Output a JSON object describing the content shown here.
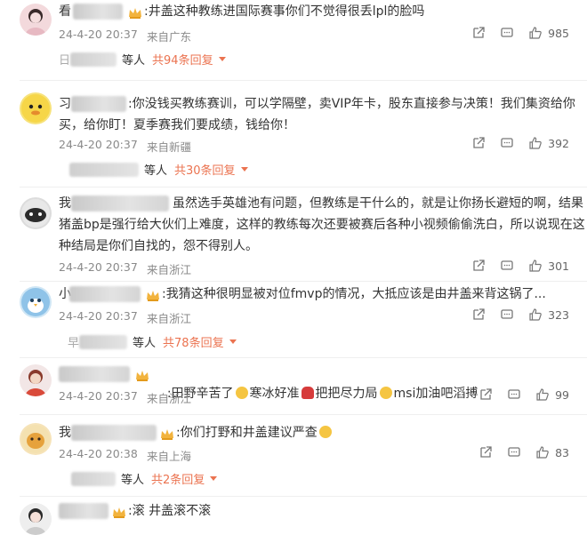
{
  "comments": [
    {
      "name_visible": "看",
      "text": ":井盖这种教练进国际赛事你们不觉得很丢lpl的脸吗",
      "date": "24-4-20 20:37",
      "location": "来自广东",
      "likes": "985",
      "reply_prefix": "日",
      "reply_people": "等人",
      "reply_count": "共94条回复"
    },
    {
      "name_visible": "习",
      "text_line1": ":你没钱买教练赛训，可以学隔壁，卖VIP年卡，股东直接参与决策！我们集资给你",
      "text_line2": "买，给你盯！夏季赛我们要成绩，钱给你！",
      "date": "24-4-20 20:37",
      "location": "来自新疆",
      "likes": "392",
      "reply_people": "等人",
      "reply_count": "共30条回复"
    },
    {
      "name_visible": "我",
      "text_line1": "虽然选手英雄池有问题，但教练是干什么的，就是让你扬长避短的啊，结果",
      "text_line2": "猪盖bp是强行给大伙们上难度，这样的教练每次还要被赛后各种小视频偷偷洗白，所以说现在这",
      "text_line3": "种结局是你们自找的，怨不得别人。",
      "date": "24-4-20 20:37",
      "location": "来自浙江",
      "likes": "301"
    },
    {
      "name_visible": "小",
      "text": ":我猜这种很明显被对位fmvp的情况，大抵应该是由井盖来背这锅了...",
      "date": "24-4-20 20:37",
      "location": "来自浙江",
      "likes": "323",
      "reply_prefix": "早",
      "reply_people": "等人",
      "reply_count": "共78条回复"
    },
    {
      "text_part1": ":田野辛苦了",
      "text_part2": "寒冰好准",
      "text_part3": "把把尽力局",
      "text_part4": "msi加油吧滔搏",
      "date": "24-4-20 20:37",
      "location": "来自浙江",
      "likes": "99"
    },
    {
      "name_visible": "我",
      "text": ":你们打野和井盖建议严查",
      "date": "24-4-20 20:38",
      "location": "来自上海",
      "likes": "83",
      "reply_people": "等人",
      "reply_count": "共2条回复"
    },
    {
      "text": ":滚 井盖滚不滚"
    }
  ]
}
